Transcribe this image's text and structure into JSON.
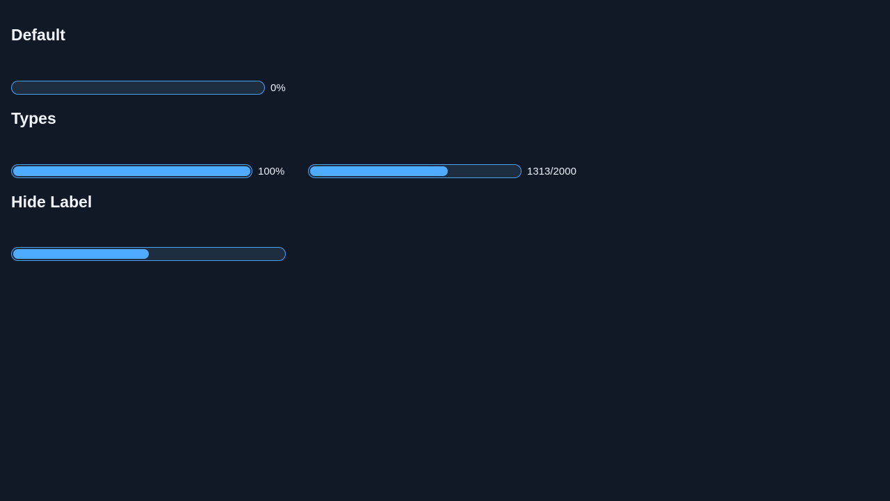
{
  "sections": {
    "default": {
      "title": "Default",
      "bar": {
        "value": 0,
        "max": 100,
        "label": "0%"
      }
    },
    "types": {
      "title": "Types",
      "bars": [
        {
          "value": 100,
          "max": 100,
          "label": "100%"
        },
        {
          "value": 1313,
          "max": 2000,
          "label": "1313/2000"
        }
      ]
    },
    "hide_label": {
      "title": "Hide Label",
      "bar": {
        "value": 50,
        "max": 100
      }
    }
  },
  "colors": {
    "background": "#111826",
    "track": "#1f2d40",
    "fill": "#4eabff",
    "border": "#4aa3ff"
  }
}
